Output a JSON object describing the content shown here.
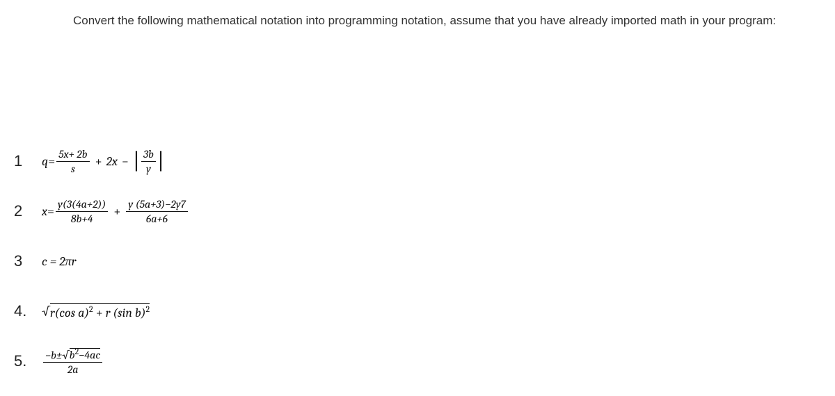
{
  "instruction": "Convert the following mathematical notation into programming notation, assume that you have already imported math in your program:",
  "items": {
    "n1": "1",
    "n2": "2",
    "n3": "3",
    "n4": "4.",
    "n5": "5."
  },
  "eq1": {
    "lhs_var": "q",
    "eq": " = ",
    "f1_top": "5x+ 2b",
    "f1_bot": "s",
    "plus": " + ",
    "mid": "2x",
    "minus": " − ",
    "f2_top": "3b",
    "f2_bot": "y"
  },
  "eq2": {
    "lhs_var": "x",
    "eq": " = ",
    "f1_top": "y(3(4a+2))",
    "f1_bot": "8b+4",
    "plus": " + ",
    "f2_top": "y (5a+3)−2y7",
    "f2_bot": "6a+6"
  },
  "eq3": {
    "full": "c = 2πr"
  },
  "eq4": {
    "sqrt": "√",
    "under1a": "r(cos a)",
    "sup1": "2",
    "plus": " + ",
    "under2a": "r (sin b)",
    "sup2": "2"
  },
  "eq5": {
    "top_a": "−b±",
    "top_sqrt": "√",
    "top_under": "b",
    "top_sup": "2",
    "top_b": "−4ac",
    "bot": "2a"
  }
}
